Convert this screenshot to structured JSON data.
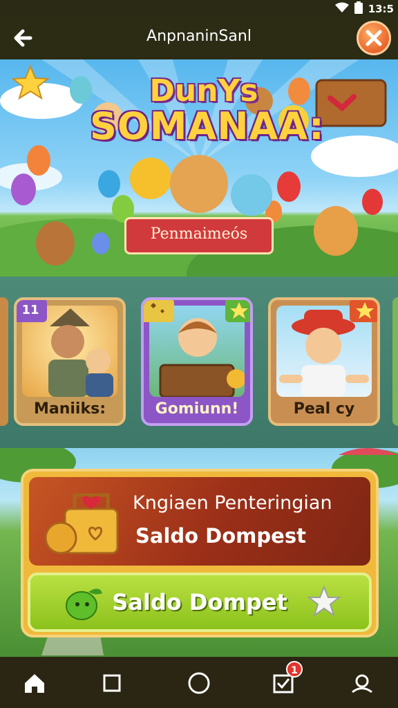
{
  "status_bar": {
    "time": "13:5"
  },
  "header": {
    "title": "AnpnaninSanl"
  },
  "banner": {
    "title_line1": "DunYs",
    "title_line2": "SOMANAA:",
    "ribbon": "Penmaimeós"
  },
  "cards": [
    {
      "badge": "11",
      "label": "Maniiks:"
    },
    {
      "badge": "",
      "label": "Gomiunn!"
    },
    {
      "badge": "",
      "label": "Peal cy"
    }
  ],
  "wallet": {
    "heading": "Kngiaen Penteringian",
    "subheading": "Saldo Dompest",
    "button_label": "Saldo Dompet"
  },
  "nav": {
    "notification_count": "1"
  },
  "colors": {
    "header_bg": "#2c2b14",
    "accent_orange": "#e9642a",
    "button_green": "#8cc21c",
    "panel_red": "#9b2f18"
  }
}
